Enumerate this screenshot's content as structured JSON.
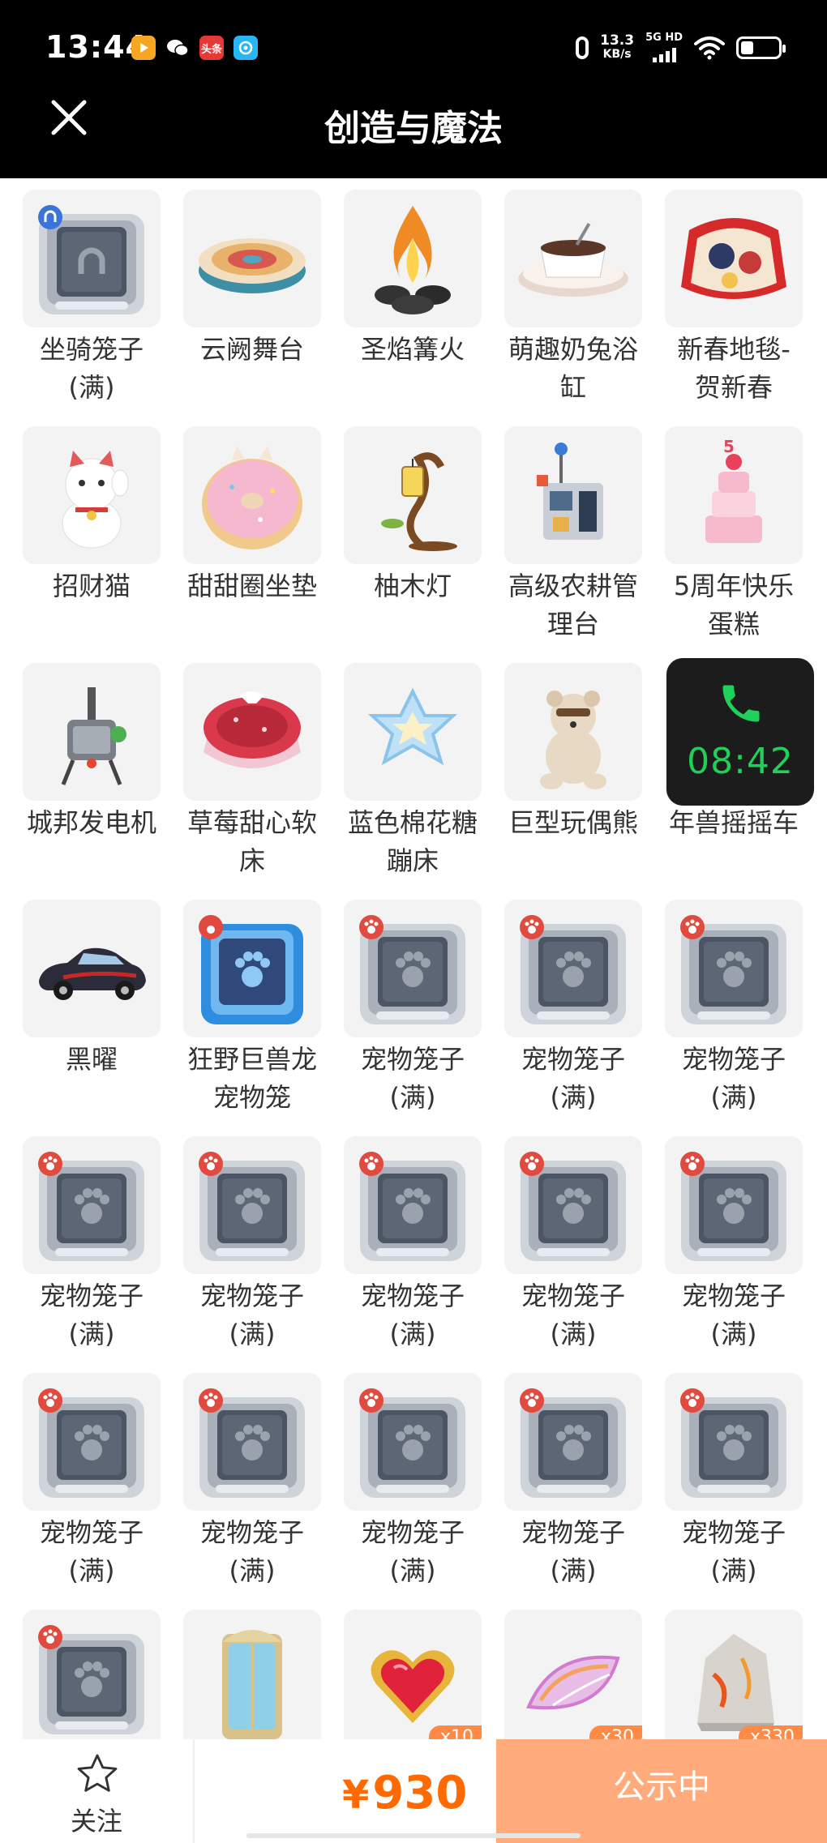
{
  "status_bar": {
    "time": "13:44",
    "apps": [
      {
        "icon": "video-app-icon",
        "label": "",
        "color": "#f5a623"
      },
      {
        "icon": "wechat-icon",
        "label": "",
        "color": "#ffffff"
      },
      {
        "icon": "toutiao-icon",
        "label": "头条",
        "color": "#e53935"
      },
      {
        "icon": "gallery-app-icon",
        "label": "",
        "color": "#29b6f6"
      }
    ],
    "net_speed": "13.3",
    "net_unit": "KB/s",
    "net_type": "5G HD",
    "battery_level": 0.35
  },
  "header": {
    "title": "创造与魔法",
    "close_icon": "close-icon"
  },
  "items": [
    {
      "name": "坐骑笼子\n(满)",
      "icon": "mount-cage-icon"
    },
    {
      "name": "云阙舞台",
      "icon": "cloud-stage-icon"
    },
    {
      "name": "圣焰篝火",
      "icon": "bonfire-icon"
    },
    {
      "name": "萌趣奶兔浴\n缸",
      "icon": "bunny-bathtub-icon"
    },
    {
      "name": "新春地毯-\n贺新春",
      "icon": "new-year-carpet-icon"
    },
    {
      "name": "招财猫",
      "icon": "lucky-cat-icon"
    },
    {
      "name": "甜甜圈坐垫",
      "icon": "donut-cushion-icon"
    },
    {
      "name": "柚木灯",
      "icon": "teak-lamp-icon"
    },
    {
      "name": "高级农耕管\n理台",
      "icon": "farm-console-icon"
    },
    {
      "name": "5周年快乐\n蛋糕",
      "icon": "cake-icon"
    },
    {
      "name": "城邦发电机",
      "icon": "generator-icon"
    },
    {
      "name": "草莓甜心软\n床",
      "icon": "strawberry-bed-icon"
    },
    {
      "name": "蓝色棉花糖\n蹦床",
      "icon": "trampoline-icon"
    },
    {
      "name": "巨型玩偶熊",
      "icon": "teddy-bear-icon"
    },
    {
      "name": "年兽摇摇车",
      "icon": "rocking-car-icon"
    },
    {
      "name": "黑曜",
      "icon": "car-icon"
    },
    {
      "name": "狂野巨兽龙\n宠物笼",
      "icon": "dragon-pet-cage-icon"
    },
    {
      "name": "宠物笼子\n(满)",
      "icon": "pet-cage-icon"
    },
    {
      "name": "宠物笼子\n(满)",
      "icon": "pet-cage-icon"
    },
    {
      "name": "宠物笼子\n(满)",
      "icon": "pet-cage-icon"
    },
    {
      "name": "宠物笼子\n(满)",
      "icon": "pet-cage-icon"
    },
    {
      "name": "宠物笼子\n(满)",
      "icon": "pet-cage-icon"
    },
    {
      "name": "宠物笼子\n(满)",
      "icon": "pet-cage-icon"
    },
    {
      "name": "宠物笼子\n(满)",
      "icon": "pet-cage-icon"
    },
    {
      "name": "宠物笼子\n(满)",
      "icon": "pet-cage-icon"
    },
    {
      "name": "宠物笼子\n(满)",
      "icon": "pet-cage-icon"
    },
    {
      "name": "宠物笼子\n(满)",
      "icon": "pet-cage-icon"
    },
    {
      "name": "宠物笼子\n(满)",
      "icon": "pet-cage-icon"
    },
    {
      "name": "宠物笼子\n(满)",
      "icon": "pet-cage-icon"
    },
    {
      "name": "宠物笼子\n(满)",
      "icon": "pet-cage-icon"
    },
    {
      "name": "",
      "icon": "pet-cage-icon"
    },
    {
      "name": "",
      "icon": "wardrobe-icon"
    },
    {
      "name": "",
      "icon": "heart-gem-icon",
      "qty": "x10"
    },
    {
      "name": "",
      "icon": "crystal-slice-icon",
      "qty": "x30"
    },
    {
      "name": "",
      "icon": "rock-icon",
      "qty": "x330"
    }
  ],
  "call_overlay": {
    "icon": "phone-icon",
    "time": "08:42"
  },
  "bottom_bar": {
    "follow_label": "关注",
    "follow_icon": "star-icon",
    "price_symbol": "¥",
    "price": "930",
    "status_label": "公示中"
  },
  "colors": {
    "price": "#ff6a00",
    "status_button": "#ffab7b",
    "call_green": "#1fd05a"
  }
}
